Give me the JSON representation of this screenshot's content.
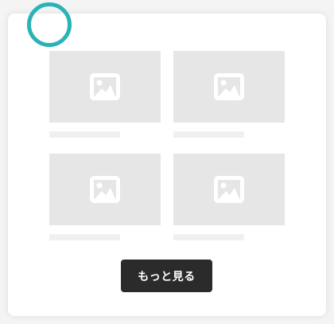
{
  "colors": {
    "ring": "#29b3b8",
    "placeholder": "#e6e6e6",
    "button_bg": "#2b2b2b",
    "button_text": "#ffffff"
  },
  "gallery": {
    "items": [
      {
        "icon": "image-placeholder-icon"
      },
      {
        "icon": "image-placeholder-icon"
      },
      {
        "icon": "image-placeholder-icon"
      },
      {
        "icon": "image-placeholder-icon"
      }
    ]
  },
  "more_button": {
    "label": "もっと見る"
  }
}
